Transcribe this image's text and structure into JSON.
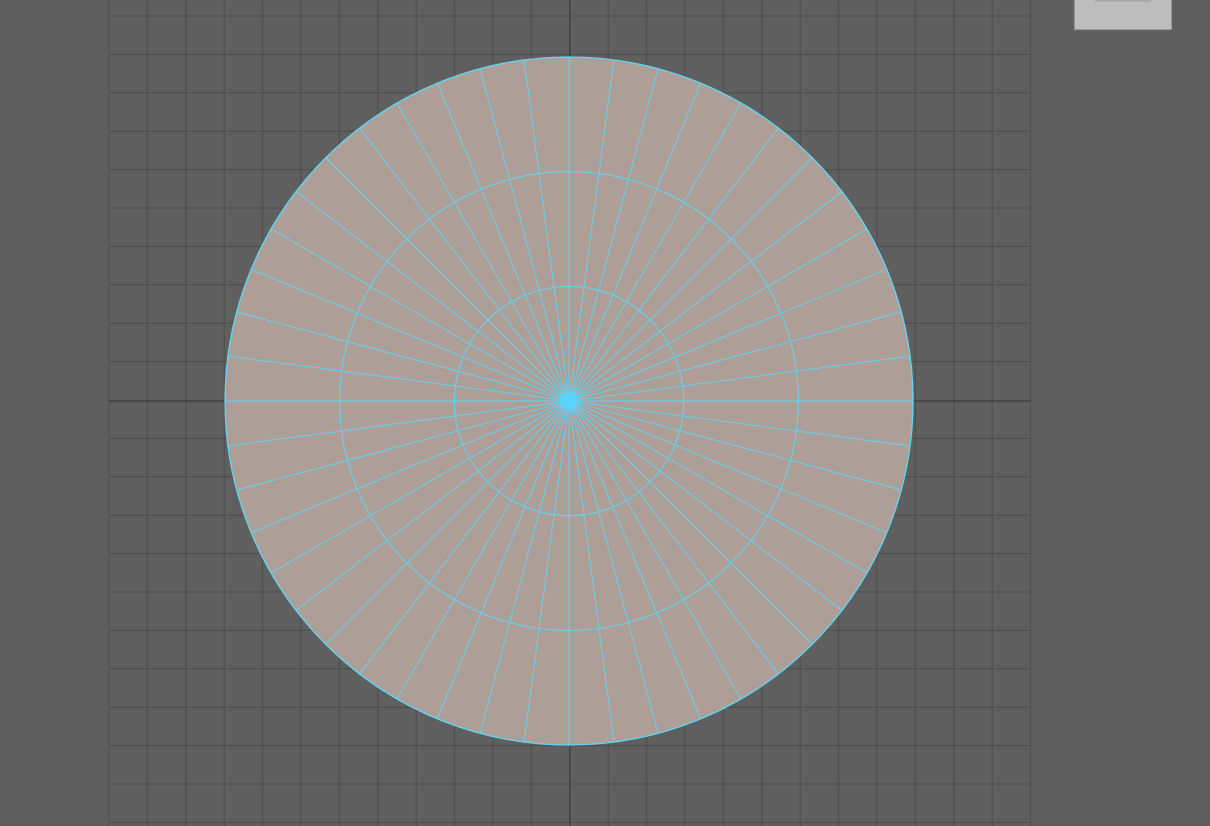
{
  "viewport": {
    "background_color": "#5f5f5f",
    "grid": {
      "visible": true,
      "line_color": "#4c4c4c",
      "axis_color": "#404040",
      "cells_horizontal": 24,
      "cells_vertical": 22,
      "origin_cell_column": 12,
      "origin_cell_row": 11
    },
    "uv_disc": {
      "face_color": "#ad9f97",
      "edge_color": "#5fd6f5",
      "center_vertex_color": "#59d2ff",
      "radial_segments": 48,
      "ring_count": 3,
      "selected_center_vertex": true
    }
  },
  "corner_widget": {
    "background_color": "#bdbdbd"
  }
}
